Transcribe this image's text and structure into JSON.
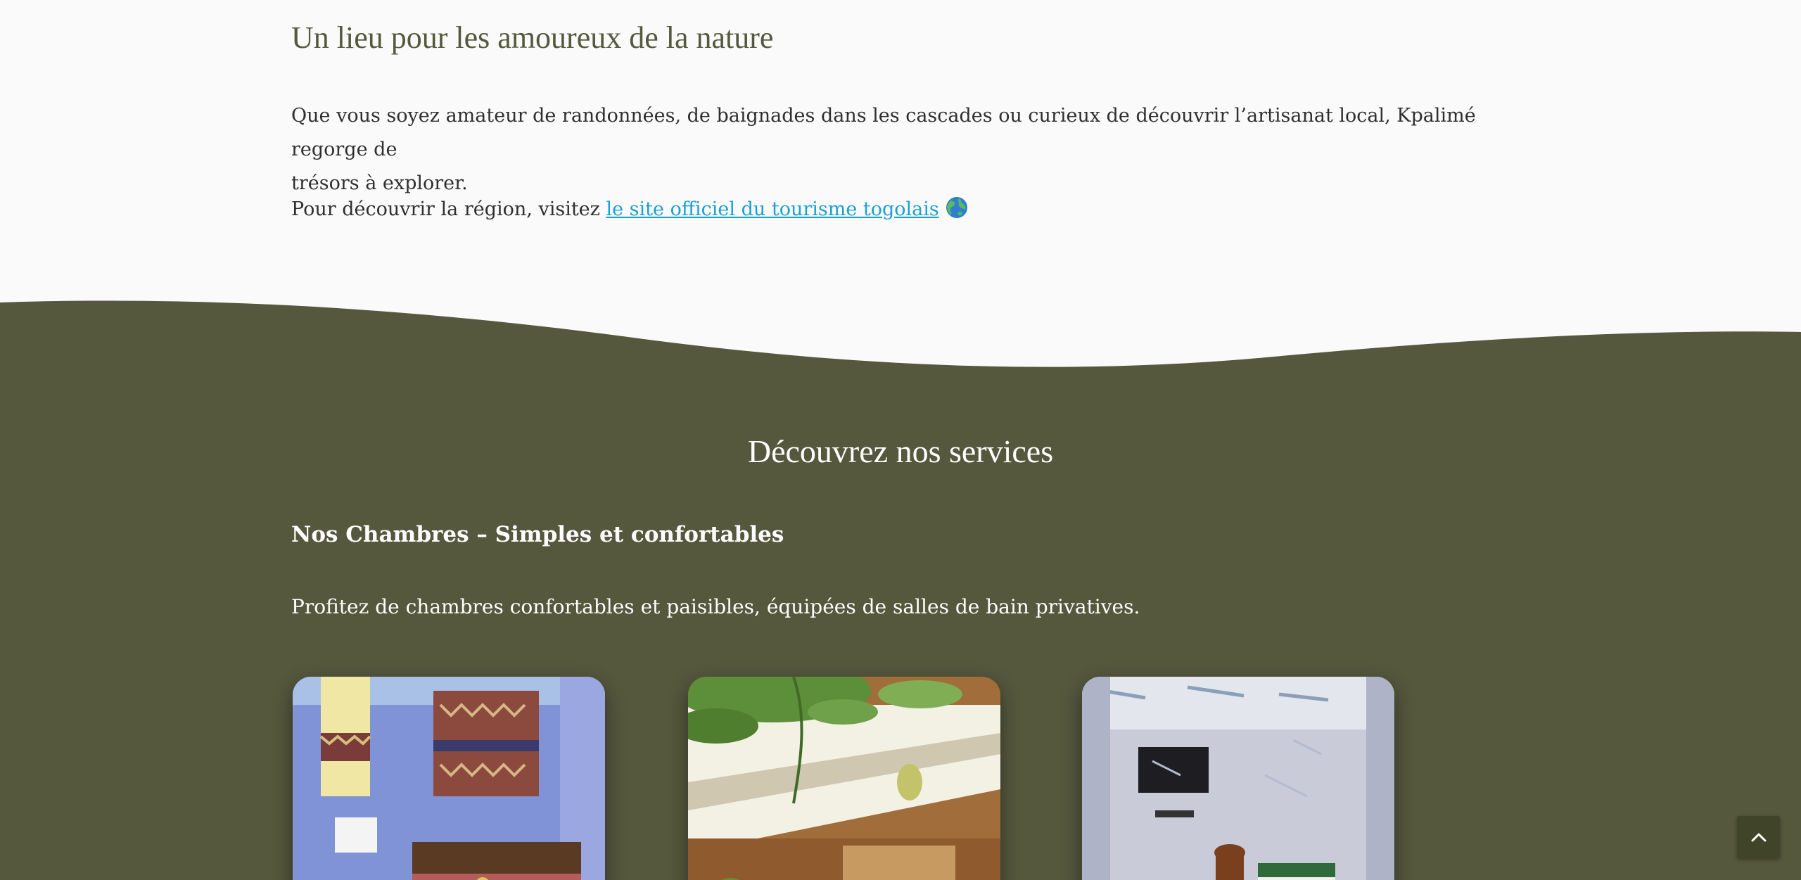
{
  "intro": {
    "title": "Un lieu pour les amoureux de la nature",
    "paragraph1_line1": "Que vous soyez amateur de randonnées, de baignades dans les cascades ou curieux de découvrir l’artisanat local, Kpalimé regorge de",
    "paragraph1_line2": "trésors à explorer.",
    "paragraph2_prefix": "Pour découvrir la région, visitez ",
    "paragraph2_link": "le site officiel du tourisme togolais",
    "paragraph2_icon": "globe-icon"
  },
  "services": {
    "title": "Découvrez nos services",
    "rooms_heading": "Nos Chambres – Simples et confortables",
    "rooms_description": "Profitez de chambres confortables et paisibles, équipées de salles de bain privatives.",
    "cards": [
      {
        "image": "bedroom-photo"
      },
      {
        "image": "terrace-photo"
      },
      {
        "image": "room-tv-photo"
      }
    ]
  },
  "scroll_top": {
    "icon": "chevron-up-icon"
  },
  "colors": {
    "background": "#fafafa",
    "olive": "#55583d",
    "intro_title": "#55593d",
    "link": "#1a9fd6",
    "button": "#404529"
  }
}
